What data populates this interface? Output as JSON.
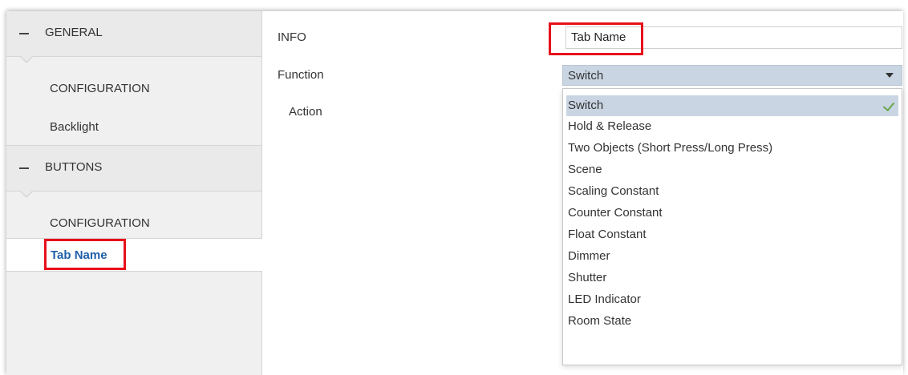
{
  "sidebar": {
    "general": {
      "label": "GENERAL",
      "items": [
        "CONFIGURATION",
        "Backlight"
      ]
    },
    "buttons": {
      "label": "BUTTONS",
      "items": [
        "CONFIGURATION",
        "Tab Name"
      ]
    }
  },
  "form": {
    "info_label": "INFO",
    "tab_name_value": "Tab Name",
    "function_label": "Function",
    "function_value": "Switch",
    "action_label": "Action"
  },
  "dropdown": {
    "options": [
      "Switch",
      "Hold & Release",
      "Two Objects (Short Press/Long Press)",
      "Scene",
      "Scaling Constant",
      "Counter Constant",
      "Float Constant",
      "Dimmer",
      "Shutter",
      "LED Indicator",
      "Room State"
    ],
    "selected": "Switch"
  },
  "colors": {
    "highlight": "#e8101a",
    "active_link": "#1f5fa8",
    "select_bg": "#c9d5e2",
    "check": "#6aa84f"
  },
  "icons": [
    "collapse-icon",
    "dropdown-arrow-icon",
    "checkmark-icon"
  ]
}
